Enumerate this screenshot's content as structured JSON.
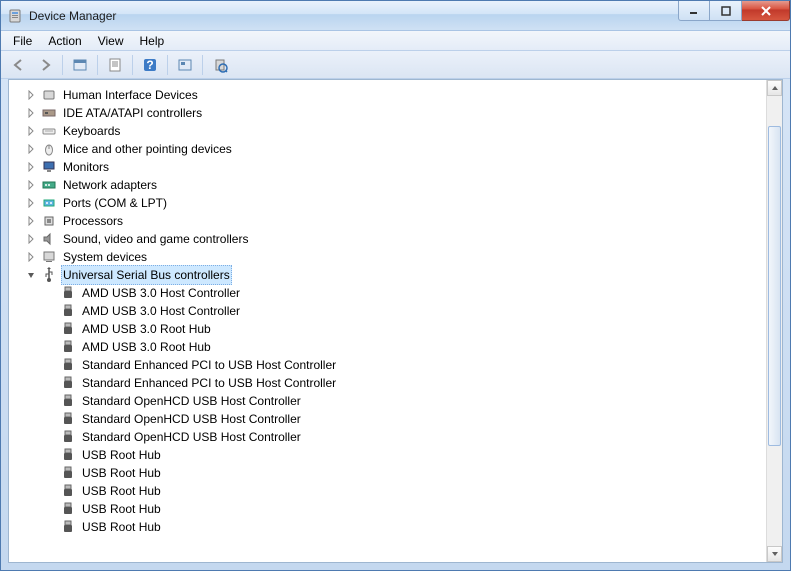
{
  "window": {
    "title": "Device Manager"
  },
  "menu": {
    "file": "File",
    "action": "Action",
    "view": "View",
    "help": "Help"
  },
  "categories": [
    {
      "label": "Human Interface Devices",
      "icon": "hid"
    },
    {
      "label": "IDE ATA/ATAPI controllers",
      "icon": "ide"
    },
    {
      "label": "Keyboards",
      "icon": "keyboard"
    },
    {
      "label": "Mice and other pointing devices",
      "icon": "mouse"
    },
    {
      "label": "Monitors",
      "icon": "monitor"
    },
    {
      "label": "Network adapters",
      "icon": "network"
    },
    {
      "label": "Ports (COM & LPT)",
      "icon": "port"
    },
    {
      "label": "Processors",
      "icon": "cpu"
    },
    {
      "label": "Sound, video and game controllers",
      "icon": "sound"
    },
    {
      "label": "System devices",
      "icon": "system"
    }
  ],
  "expanded": {
    "label": "Universal Serial Bus controllers",
    "children": [
      "AMD USB 3.0 Host Controller",
      "AMD USB 3.0 Host Controller",
      "AMD USB 3.0 Root Hub",
      "AMD USB 3.0 Root Hub",
      "Standard Enhanced PCI to USB Host Controller",
      "Standard Enhanced PCI to USB Host Controller",
      "Standard OpenHCD USB Host Controller",
      "Standard OpenHCD USB Host Controller",
      "Standard OpenHCD USB Host Controller",
      "USB Root Hub",
      "USB Root Hub",
      "USB Root Hub",
      "USB Root Hub",
      "USB Root Hub"
    ]
  }
}
